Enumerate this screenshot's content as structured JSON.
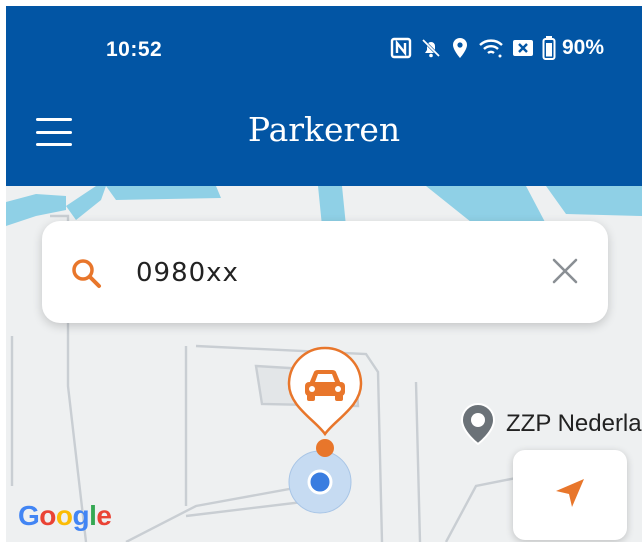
{
  "status_bar": {
    "time": "10:52",
    "battery": "90%"
  },
  "app_bar": {
    "title": "Parkeren",
    "menu_icon": "hamburger-menu-icon"
  },
  "search": {
    "value": "0980xx",
    "search_icon": "search-icon",
    "clear_icon": "close-icon"
  },
  "map": {
    "poi_label": "ZZP Nederla",
    "attribution": "Google",
    "locate_icon": "navigation-arrow-icon",
    "marker_icon": "car-icon"
  },
  "colors": {
    "app_bar": "#0255a4",
    "accent_orange": "#e8762b",
    "location_blue": "#3a7de0",
    "map_water": "#8fd0e6",
    "map_road": "#c9ced3"
  }
}
